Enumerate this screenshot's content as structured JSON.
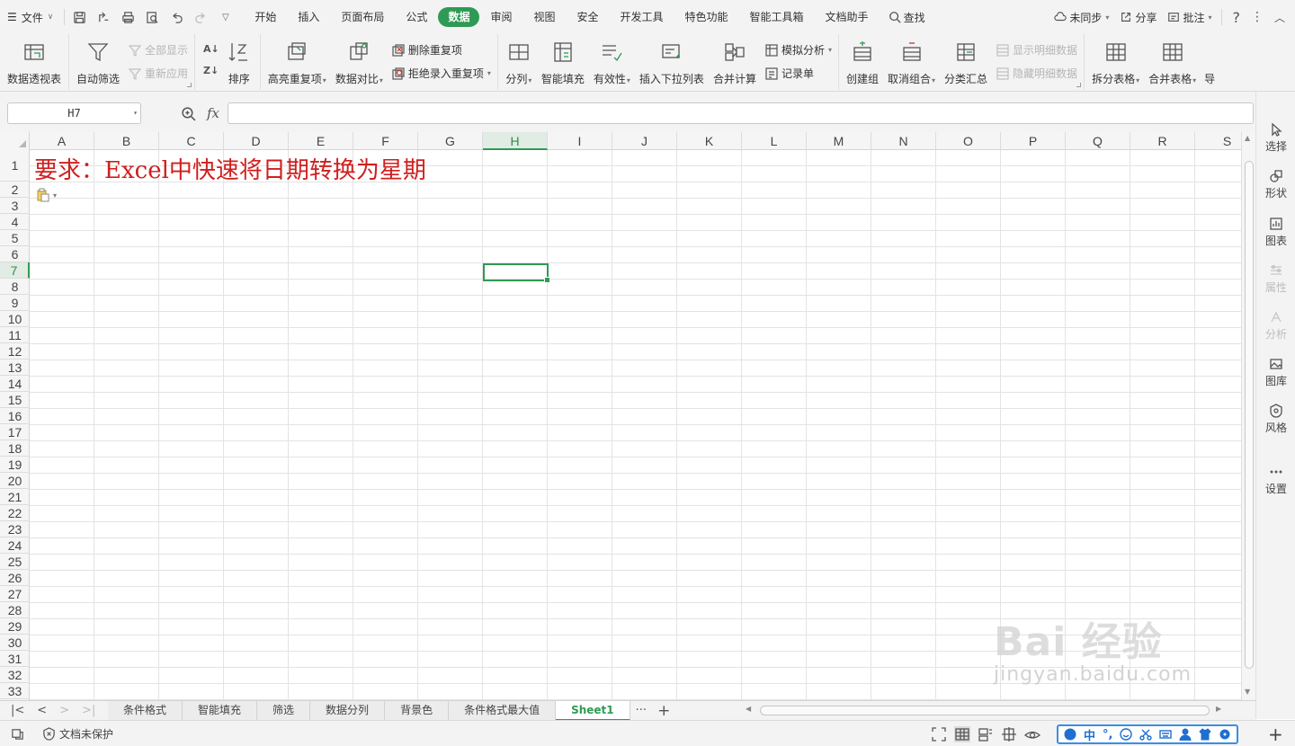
{
  "menubar": {
    "file_label": "文件",
    "tabs": [
      "开始",
      "插入",
      "页面布局",
      "公式",
      "数据",
      "审阅",
      "视图",
      "安全",
      "开发工具",
      "特色功能",
      "智能工具箱",
      "文档助手"
    ],
    "search_label": "查找",
    "right": {
      "sync": "未同步",
      "share": "分享",
      "comment": "批注"
    }
  },
  "ribbon": {
    "pivot": "数据透视表",
    "autofilter": "自动筛选",
    "show_all": "全部显示",
    "reapply": "重新应用",
    "sort": "排序",
    "highlight_dup": "高亮重复项",
    "data_compare": "数据对比",
    "delete_dup": "删除重复项",
    "reject_dup": "拒绝录入重复项",
    "split_col": "分列",
    "smart_fill": "智能填充",
    "validity": "有效性",
    "insert_dropdown": "插入下拉列表",
    "merge_calc": "合并计算",
    "simulate": "模拟分析",
    "record_form": "记录单",
    "create_group": "创建组",
    "ungroup": "取消组合",
    "subtotal": "分类汇总",
    "show_detail": "显示明细数据",
    "hide_detail": "隐藏明细数据",
    "split_table": "拆分表格",
    "merge_table": "合并表格",
    "more": "导"
  },
  "formulabar": {
    "namebox": "H7",
    "fx": "fx",
    "value": ""
  },
  "grid": {
    "columns": [
      "A",
      "B",
      "C",
      "D",
      "E",
      "F",
      "G",
      "H",
      "I",
      "J",
      "K",
      "L",
      "M",
      "N",
      "O",
      "P",
      "Q",
      "R",
      "S"
    ],
    "rows": [
      "1",
      "2",
      "3",
      "4",
      "5",
      "6",
      "7",
      "8",
      "9",
      "10",
      "11",
      "12",
      "13",
      "14",
      "15",
      "16",
      "17",
      "18",
      "19",
      "20",
      "21",
      "22",
      "23",
      "24",
      "25",
      "26",
      "27",
      "28",
      "29",
      "30",
      "31",
      "32",
      "33"
    ],
    "selected_col": "H",
    "selected_row": "7",
    "a1_text": "要求：Excel中快速将日期转换为星期"
  },
  "sidepanel": {
    "items": [
      {
        "label": "选择",
        "icon": "cursor-icon",
        "enabled": true
      },
      {
        "label": "形状",
        "icon": "shape-icon",
        "enabled": true
      },
      {
        "label": "图表",
        "icon": "chart-icon",
        "enabled": true
      },
      {
        "label": "属性",
        "icon": "properties-icon",
        "enabled": false
      },
      {
        "label": "分析",
        "icon": "analysis-icon",
        "enabled": false
      },
      {
        "label": "图库",
        "icon": "gallery-icon",
        "enabled": true
      },
      {
        "label": "风格",
        "icon": "style-icon",
        "enabled": true
      },
      {
        "label": "设置",
        "icon": "more-icon",
        "enabled": true
      }
    ]
  },
  "sheets": {
    "tabs": [
      "条件格式",
      "智能填充",
      "筛选",
      "数据分列",
      "背景色",
      "条件格式最大值",
      "Sheet1"
    ],
    "active": "Sheet1"
  },
  "statusbar": {
    "protect": "文档未保护",
    "ime_lang": "中"
  },
  "watermark": {
    "line1": "Bai 经验",
    "line2": "jingyan.baidu.com"
  },
  "colors": {
    "accent": "#2f9a55",
    "title_red": "#d01f1f"
  }
}
